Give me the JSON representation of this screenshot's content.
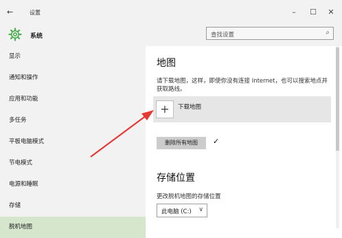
{
  "titlebar": {
    "back_glyph": "←",
    "title": "设置",
    "min_glyph": "–",
    "max_glyph": "☐",
    "close_glyph": "✕"
  },
  "header": {
    "app_name": "系统",
    "search_placeholder": "查找设置",
    "search_glyph": "⌕"
  },
  "sidebar": {
    "items": [
      {
        "label": "显示"
      },
      {
        "label": "通知和操作"
      },
      {
        "label": "应用和功能"
      },
      {
        "label": "多任务"
      },
      {
        "label": "平板电脑模式"
      },
      {
        "label": "节电模式"
      },
      {
        "label": "电源和睡眠"
      },
      {
        "label": "存储"
      },
      {
        "label": "脱机地图"
      }
    ],
    "selected_index": 8
  },
  "main": {
    "map_heading": "地图",
    "map_desc": "请下载地图，这样，即使你没有连接 Internet，也可以搜索地点并获取路线。",
    "download_plus": "+",
    "download_label": "下载地图",
    "delete_all_label": "删除所有地图",
    "check_glyph": "✓",
    "storage_heading": "存储位置",
    "storage_label": "更改脱机地图的存储位置",
    "storage_value": "此电脑 (C:)",
    "storage_chevron": "∨"
  },
  "colors": {
    "accent_green": "#4caf50",
    "selected_bg": "#d6e6cd",
    "arrow_red": "#e53935"
  },
  "icons": {
    "app_icon": "gear-icon"
  }
}
